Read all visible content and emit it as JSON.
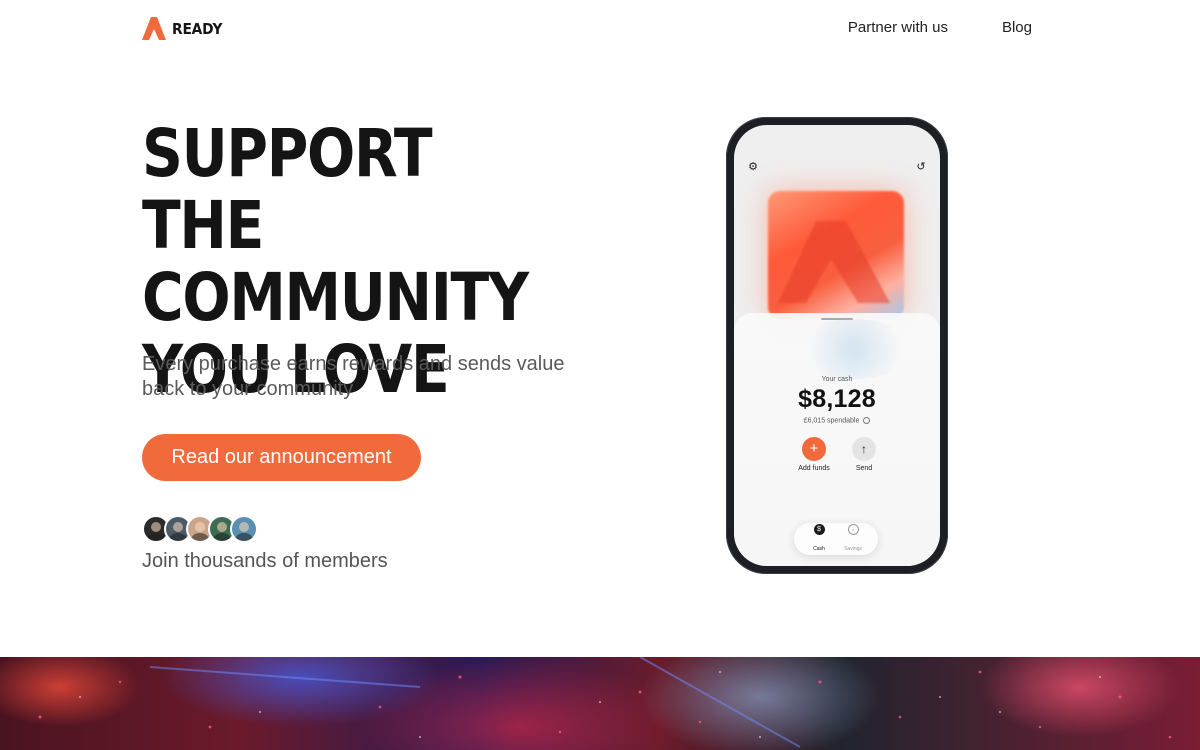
{
  "brand": {
    "name": "READY",
    "accent_color": "#f06a3c",
    "logo_icon": "ready-logo-icon"
  },
  "nav": {
    "items": [
      {
        "label": "Partner with us"
      },
      {
        "label": "Blog"
      }
    ]
  },
  "hero": {
    "title_lines": [
      "SUPPORT THE",
      "COMMUNITY",
      "YOU LOVE"
    ],
    "subtitle": "Every purchase earns rewards and sends value back to your community",
    "cta_label": "Read our announcement",
    "members_text": "Join thousands of members",
    "avatar_colors": [
      "#2b2b2b",
      "#4a5a66",
      "#c9a58a",
      "#3e6b54",
      "#5a8fb0"
    ]
  },
  "phone": {
    "settings_icon": "gear-icon",
    "history_icon": "history-icon",
    "cash_label": "Your cash",
    "cash_amount": "$8,128",
    "spendable": "£6,015 spendable",
    "actions": [
      {
        "label": "Add funds",
        "icon": "plus-icon"
      },
      {
        "label": "Send",
        "icon": "arrow-up-icon"
      }
    ],
    "tabs": [
      {
        "label": "Cash",
        "icon": "dollar-icon"
      },
      {
        "label": "Savings",
        "icon": "piggy-bank-icon"
      }
    ]
  }
}
